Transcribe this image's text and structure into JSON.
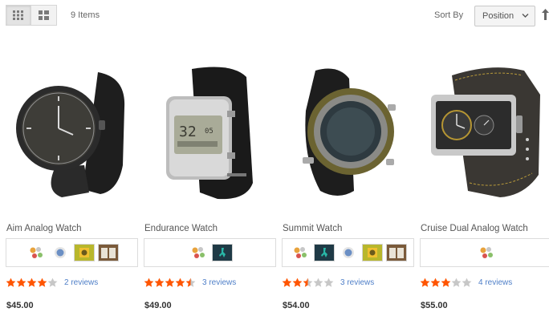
{
  "toolbar": {
    "item_count": "9 Items",
    "sort_label": "Sort By",
    "sort_value": "Position"
  },
  "colors": {
    "star_filled": "#ff5501",
    "star_empty": "#c7c7c7",
    "review_link": "#4f7fc8"
  },
  "products": [
    {
      "name": "Aim Analog Watch",
      "swatches": [
        "multicolor-dots",
        "blue-badge",
        "yellow-photo",
        "brown-photo"
      ],
      "rating_stars": 4,
      "reviews": "2 reviews",
      "price": "$45.00"
    },
    {
      "name": "Endurance Watch",
      "swatches": [
        "multicolor-dots",
        "teal-runner"
      ],
      "rating_stars": 4.5,
      "reviews": "3 reviews",
      "price": "$49.00"
    },
    {
      "name": "Summit Watch",
      "swatches": [
        "multicolor-dots",
        "teal-runner",
        "blue-badge",
        "yellow-photo",
        "brown-photo"
      ],
      "rating_stars": 2.5,
      "reviews": "3 reviews",
      "price": "$54.00"
    },
    {
      "name": "Cruise Dual Analog Watch",
      "swatches": [
        "multicolor-dots"
      ],
      "rating_stars": 3,
      "reviews": "4 reviews",
      "price": "$55.00"
    }
  ]
}
